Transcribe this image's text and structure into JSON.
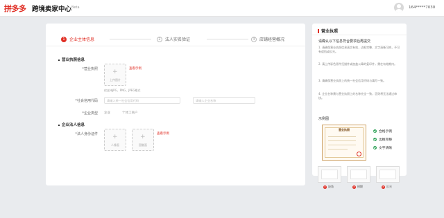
{
  "header": {
    "logo": "拼多多",
    "title": "跨境卖家中心",
    "badge": "Beta",
    "account": "164*****7030"
  },
  "steps": [
    {
      "num": "1",
      "label": "企业主体信息"
    },
    {
      "num": "2",
      "label": "法人实名验证"
    },
    {
      "num": "3",
      "label": "店铺经营概况"
    }
  ],
  "form": {
    "section_license": "营业执照信息",
    "license_label": "*营业执照",
    "upload_text": "上传图片",
    "example_link": "查看示例",
    "hint_format": "仅支持JPG、PNG、JPEG格式",
    "credit_code_label": "*社会信用代码",
    "credit_code_placeholder": "请输入统一社会信用代码",
    "company_name_label": "*企业名称",
    "company_name_placeholder": "请输入企业名称",
    "type_label": "*企业类型",
    "type_options": [
      "企业",
      "个体工商户"
    ],
    "section_legal": "企业法人信息",
    "id_label": "*法人身份证件",
    "id_front": "人像面",
    "id_back": "国徽面",
    "example_link_2": "查看示例"
  },
  "sidebar": {
    "title": "营业执照",
    "subtitle": "请确认以下信息符合要求后再提交",
    "rules": [
      "1. 请确保营业执照信息真实有效，边框完整、文字清晰可辨，不可有遮挡或反光。",
      "2. 请上传彩色原件扫描件或加盖公章的复印件，需在有效期内。",
      "3. 请确保营业执照上的统一社会信用代码与填写一致。",
      "4. 企业名称需与营业执照上的名称完全一致，否则将无法通过审核。"
    ],
    "sample_label": "示例图",
    "license_title": "营业执照",
    "checks": [
      "合格示例",
      "边框完整",
      "文字清晰"
    ],
    "bad_samples": [
      "缺角",
      "模糊",
      "反光"
    ]
  },
  "colors": {
    "brand": "#e02e24",
    "success": "#31a35a"
  }
}
